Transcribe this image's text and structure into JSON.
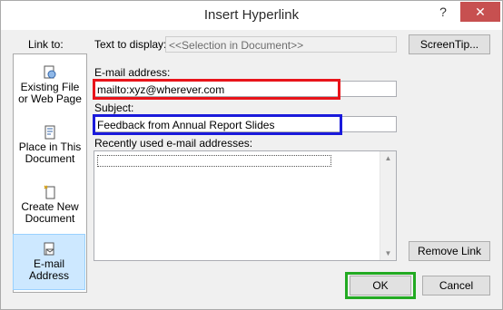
{
  "window": {
    "title": "Insert Hyperlink",
    "help_label": "?",
    "close_label": "✕"
  },
  "link_to": {
    "label": "Link to:",
    "items": [
      {
        "line1": "Existing File",
        "line2": "or Web Page",
        "icon": "web-page-icon",
        "selected": false
      },
      {
        "line1": "Place in This",
        "line2": "Document",
        "icon": "place-in-document-icon",
        "selected": false
      },
      {
        "line1": "Create New",
        "line2": "Document",
        "icon": "new-document-icon",
        "selected": false
      },
      {
        "line1": "E-mail",
        "line2": "Address",
        "icon": "email-icon",
        "selected": true
      }
    ]
  },
  "text_to_display": {
    "label": "Text to display:",
    "value": "<<Selection in Document>>"
  },
  "screentip_label": "ScreenTip...",
  "email": {
    "label": "E-mail address:",
    "value": "mailto:xyz@wherever.com"
  },
  "subject": {
    "label": "Subject:",
    "value": "Feedback from Annual Report Slides"
  },
  "recent": {
    "label": "Recently used e-mail addresses:",
    "items": []
  },
  "remove_link_label": "Remove Link",
  "ok_label": "OK",
  "cancel_label": "Cancel",
  "colors": {
    "highlight_red": "#e8141a",
    "highlight_blue": "#1a1adb",
    "highlight_green": "#22aa22",
    "close_button": "#c75050",
    "selected_item": "#cde8ff"
  }
}
